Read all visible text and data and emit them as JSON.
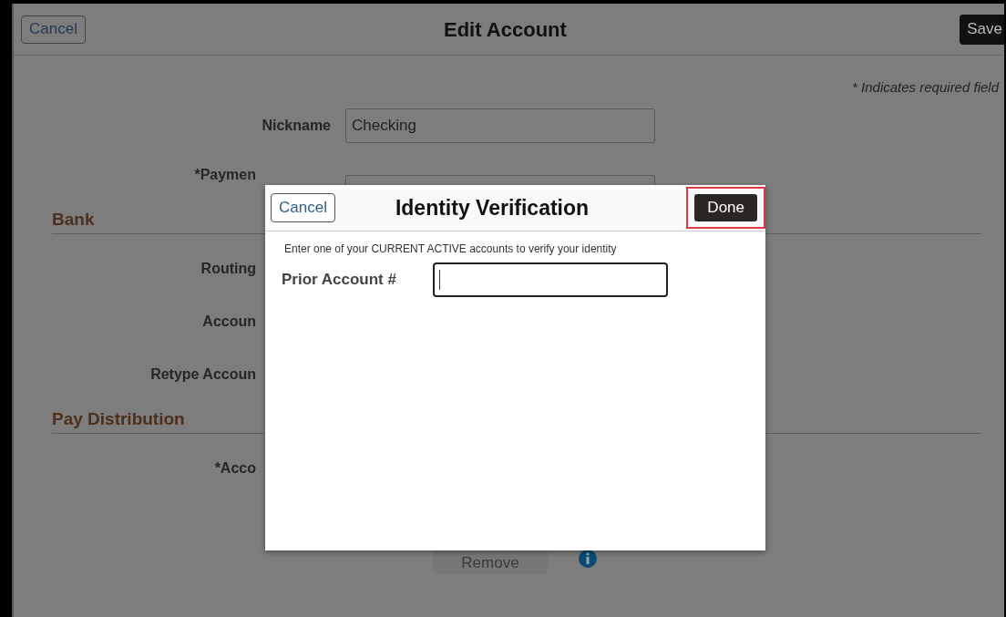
{
  "header": {
    "cancel": "Cancel",
    "title": "Edit Account",
    "save": "Save"
  },
  "required_note": "* Indicates required field",
  "fields": [
    {
      "kind": "text",
      "label": "Nickname",
      "value": "Checking"
    },
    {
      "kind": "covered",
      "label": "*Paymen"
    }
  ],
  "sections": [
    {
      "title": "Bank",
      "rows": [
        "Routing",
        "Accoun",
        "Retype Accoun"
      ]
    },
    {
      "title": "Pay Distribution",
      "rows": [
        "*Acco"
      ]
    }
  ],
  "remove_button": "Remove",
  "dialog": {
    "cancel": "Cancel",
    "title": "Identity Verification",
    "done": "Done",
    "done_highlighted": true,
    "instruction": "Enter one of your CURRENT ACTIVE accounts to verify your identity",
    "field_label": "Prior Account #"
  }
}
